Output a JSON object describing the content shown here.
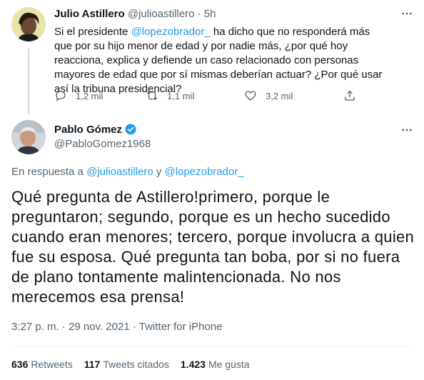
{
  "parent_tweet": {
    "author_name": "Julio Astillero",
    "author_handle": "@julioastillero",
    "separator": "·",
    "time": "5h",
    "text_before_mention": "Si el presidente ",
    "mention": "@lopezobrador_",
    "text_after_mention": " ha dicho que no responderá más que por su hijo menor de edad y por nadie más, ¿por qué hoy reacciona, explica y defiende un caso relacionado con personas mayores de edad que por sí mismas deberían actuar? ¿Por qué usar así la tribuna presidencial?",
    "actions": {
      "replies": "1,2 mil",
      "retweets": "1,1 mil",
      "likes": "3,2 mil"
    }
  },
  "main_tweet": {
    "author_name": "Pablo Gómez",
    "author_handle": "@PabloGomez1968",
    "reply_prefix": "En respuesta a ",
    "reply_mention_1": "@julioastillero",
    "reply_joiner": " y ",
    "reply_mention_2": "@lopezobrador_",
    "text": "Qué pregunta de Astillero!primero, porque le preguntaron; segundo, porque es un hecho sucedido cuando eran menores; tercero, porque involucra a quien fue su esposa. Qué pregunta tan boba, por si no fuera de plano tontamente malintencionada. No nos merecemos esa prensa!",
    "time": "3:27 p. m.",
    "dot": "·",
    "date": "29 nov. 2021",
    "source": "Twitter for iPhone",
    "stats": {
      "retweets_count": "636",
      "retweets_label": "Retweets",
      "quotes_count": "117",
      "quotes_label": "Tweets citados",
      "likes_count": "1.423",
      "likes_label": "Me gusta"
    }
  },
  "colors": {
    "accent": "#1d9bf0",
    "muted": "#536471",
    "text": "#0f1419",
    "verified": "#1d9bf0"
  },
  "icons": {
    "reply": "reply-icon",
    "retweet": "retweet-icon",
    "like": "heart-icon",
    "share": "share-icon",
    "more": "more-icon",
    "verified": "verified-badge-icon"
  }
}
